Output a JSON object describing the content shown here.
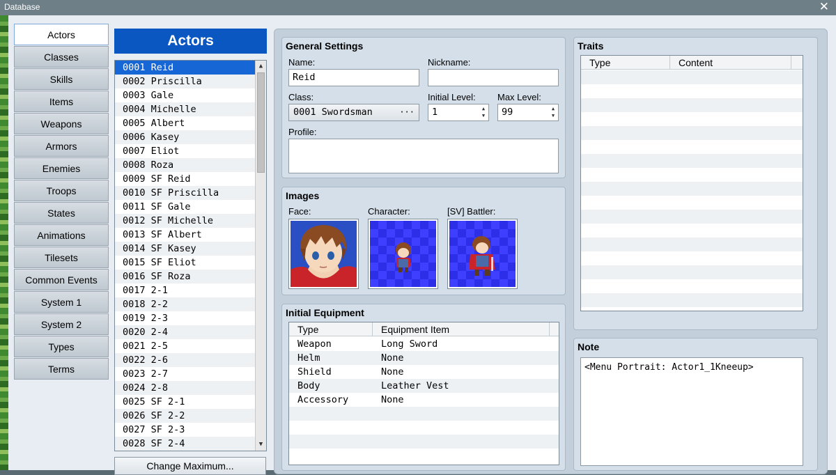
{
  "window": {
    "title": "Database",
    "close_glyph": "✕"
  },
  "categories": [
    {
      "label": "Actors",
      "active": true
    },
    {
      "label": "Classes"
    },
    {
      "label": "Skills"
    },
    {
      "label": "Items"
    },
    {
      "label": "Weapons"
    },
    {
      "label": "Armors"
    },
    {
      "label": "Enemies"
    },
    {
      "label": "Troops"
    },
    {
      "label": "States"
    },
    {
      "label": "Animations"
    },
    {
      "label": "Tilesets"
    },
    {
      "label": "Common Events"
    },
    {
      "label": "System 1"
    },
    {
      "label": "System 2"
    },
    {
      "label": "Types"
    },
    {
      "label": "Terms"
    }
  ],
  "actor_list": {
    "header": "Actors",
    "selected_index": 0,
    "items": [
      "0001 Reid",
      "0002 Priscilla",
      "0003 Gale",
      "0004 Michelle",
      "0005 Albert",
      "0006 Kasey",
      "0007 Eliot",
      "0008 Roza",
      "0009 SF Reid",
      "0010 SF Priscilla",
      "0011 SF Gale",
      "0012 SF Michelle",
      "0013 SF Albert",
      "0014 SF Kasey",
      "0015 SF Eliot",
      "0016 SF Roza",
      "0017 2-1",
      "0018 2-2",
      "0019 2-3",
      "0020 2-4",
      "0021 2-5",
      "0022 2-6",
      "0023 2-7",
      "0024 2-8",
      "0025 SF 2-1",
      "0026 SF 2-2",
      "0027 SF 2-3",
      "0028 SF 2-4"
    ],
    "change_max_label": "Change Maximum..."
  },
  "general": {
    "title": "General Settings",
    "name_label": "Name:",
    "name_value": "Reid",
    "nickname_label": "Nickname:",
    "nickname_value": "",
    "class_label": "Class:",
    "class_value": "0001 Swordsman",
    "class_button": "···",
    "initial_level_label": "Initial Level:",
    "initial_level_value": "1",
    "max_level_label": "Max Level:",
    "max_level_value": "99",
    "profile_label": "Profile:",
    "profile_value": ""
  },
  "images": {
    "title": "Images",
    "face_label": "Face:",
    "character_label": "Character:",
    "battler_label": "[SV] Battler:"
  },
  "equipment": {
    "title": "Initial Equipment",
    "headers": [
      "Type",
      "Equipment Item"
    ],
    "rows": [
      [
        "Weapon",
        "Long Sword"
      ],
      [
        "Helm",
        "None"
      ],
      [
        "Shield",
        "None"
      ],
      [
        "Body",
        "Leather Vest"
      ],
      [
        "Accessory",
        "None"
      ]
    ]
  },
  "traits": {
    "title": "Traits",
    "headers": [
      "Type",
      "Content"
    ]
  },
  "note": {
    "title": "Note",
    "value": "<Menu Portrait: Actor1_1Kneeup>"
  },
  "colors": {
    "accent": "#0a57c2",
    "selected_row": "#1766d6",
    "checker_blue": "#2d2ee8"
  }
}
